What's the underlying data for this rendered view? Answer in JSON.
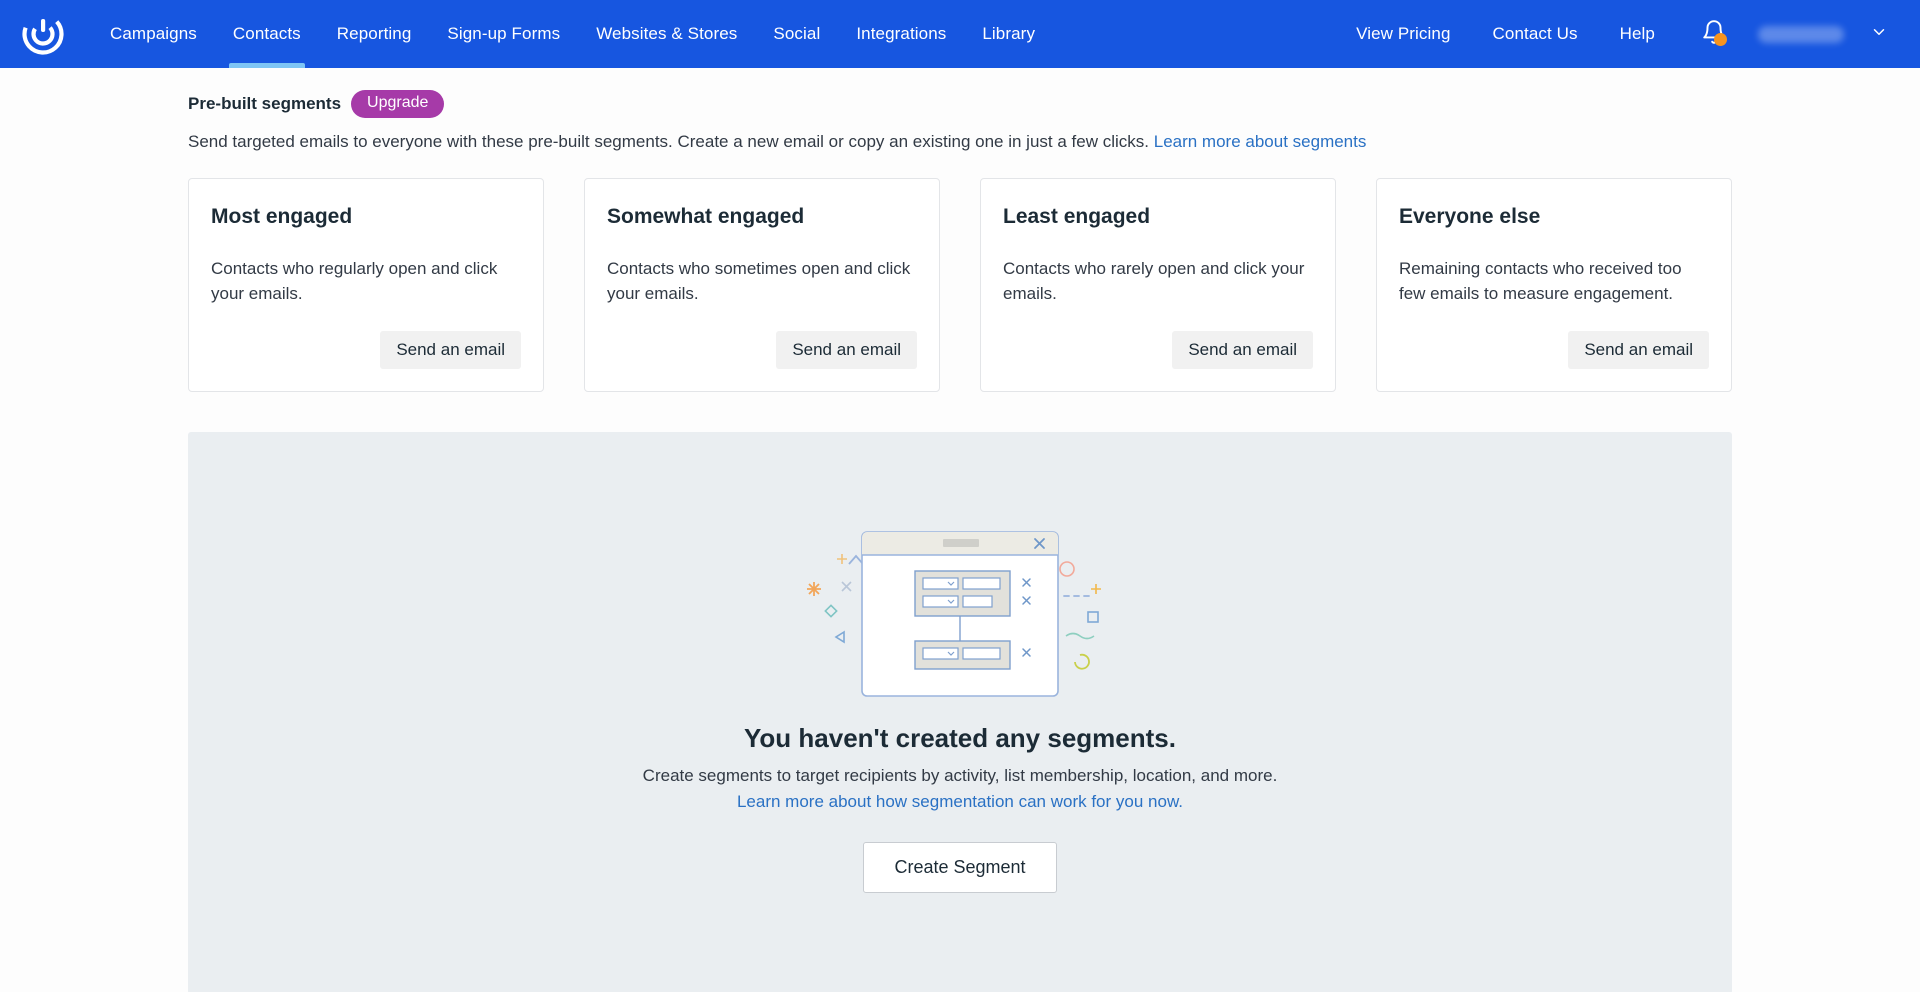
{
  "nav": {
    "logo_icon": "constant-contact-logo-icon",
    "left_items": [
      {
        "label": "Campaigns",
        "active": false
      },
      {
        "label": "Contacts",
        "active": true
      },
      {
        "label": "Reporting",
        "active": false
      },
      {
        "label": "Sign-up Forms",
        "active": false
      },
      {
        "label": "Websites & Stores",
        "active": false
      },
      {
        "label": "Social",
        "active": false
      },
      {
        "label": "Integrations",
        "active": false
      },
      {
        "label": "Library",
        "active": false
      }
    ],
    "right_items": [
      {
        "label": "View Pricing"
      },
      {
        "label": "Contact Us"
      },
      {
        "label": "Help"
      }
    ],
    "bell_icon": "notification-bell-icon",
    "bell_has_alert": true,
    "account_name": "",
    "chevron_icon": "chevron-down-icon",
    "accent_color": "#1756e0",
    "active_underline_color": "#7ec5f5",
    "alert_dot_color": "#f7941e"
  },
  "prebuilt": {
    "title": "Pre-built segments",
    "upgrade_label": "Upgrade",
    "upgrade_color": "#a63aa8",
    "description_text": "Send targeted emails to everyone with these pre-built segments. Create a new email or copy an existing one in just a few clicks.",
    "description_link": "Learn more about segments",
    "cards": [
      {
        "title": "Most engaged",
        "description": "Contacts who regularly open and click your emails.",
        "button": "Send an email"
      },
      {
        "title": "Somewhat engaged",
        "description": "Contacts who sometimes open and click your emails.",
        "button": "Send an email"
      },
      {
        "title": "Least engaged",
        "description": "Contacts who rarely open and click your emails.",
        "button": "Send an email"
      },
      {
        "title": "Everyone else",
        "description": "Remaining contacts who received too few emails to measure engagement.",
        "button": "Send an email"
      }
    ]
  },
  "empty_state": {
    "illustration_icon": "segment-builder-illustration",
    "title": "You haven't created any segments.",
    "subtitle": "Create segments to target recipients by activity, list membership, location, and more.",
    "link": "Learn more about how segmentation can work for you now.",
    "button": "Create Segment",
    "panel_color": "#eaeef1"
  }
}
